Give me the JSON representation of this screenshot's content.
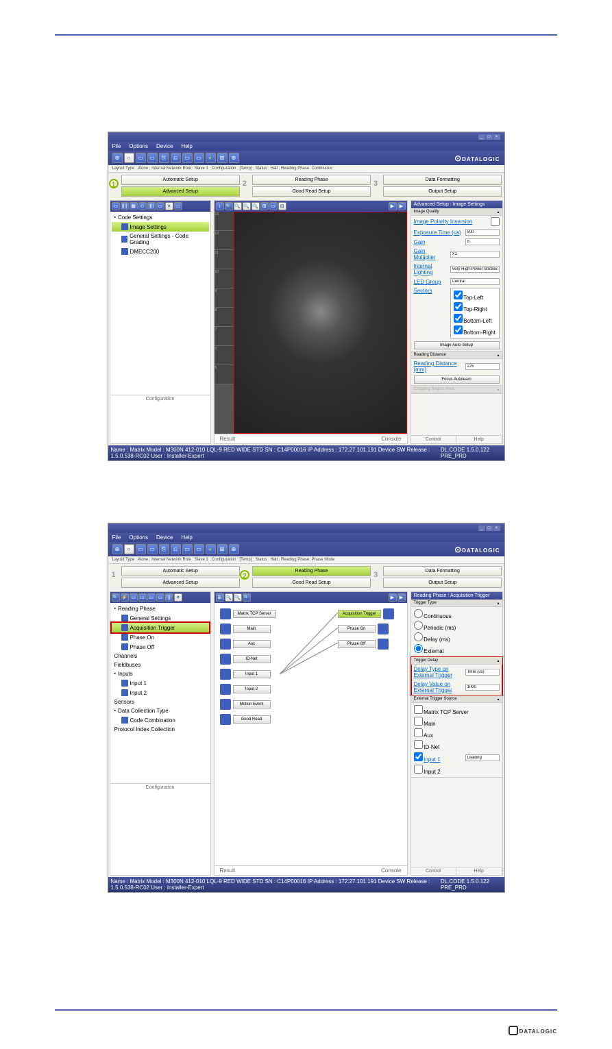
{
  "menubar": {
    "file": "File",
    "options": "Options",
    "device": "Device",
    "help": "Help"
  },
  "logo": "DATALOGIC",
  "screenshot1": {
    "breadcrumb": "Layout Type : Alone ; Internal Network Role : Slave 1 ; Configuration : [Temp] ; Status : Halt ; Reading Phase: Continuous",
    "workflow": {
      "automatic": "Automatic Setup",
      "advanced": "Advanced Setup",
      "reading": "Reading Phase",
      "goodread": "Good Read Setup",
      "dataformat": "Data Formatting",
      "output": "Output Setup"
    },
    "tree": {
      "header": "Code Settings",
      "items": [
        {
          "label": "Image Settings",
          "sel": true
        },
        {
          "label": "General Settings - Code Grading"
        },
        {
          "label": "DMECC200"
        }
      ]
    },
    "leftFooter": "Configuration",
    "centerFooter": {
      "left": "Result",
      "right": "Console"
    },
    "right": {
      "header": "Advanced Setup :  Image Settings",
      "imageQuality": "Image Quality",
      "polarityInv": "Image Polarity Inversion",
      "expTime": "Exposure Time (us)",
      "expVal": "500",
      "gain": "Gain",
      "gainVal": "8",
      "gainMult": "Gain Multiplier",
      "gainMultVal": "X1",
      "intLight": "Internal Lighting",
      "intLightVal": "Very High-Power Strobed",
      "ledGroup": "LED Group",
      "ledGroupVal": "Central",
      "sectors": "Sectors",
      "sectorList": [
        "Top-Left",
        "Top-Right",
        "Bottom-Left",
        "Bottom-Right"
      ],
      "autoSetup": "Image Auto-Setup",
      "readDist": "Reading Distance",
      "readDistMm": "Reading Distance (mm)",
      "readDistVal": "225",
      "focusAuto": "Focus Autolearn",
      "cropRegion": "Cropping Region Area"
    },
    "bottom": {
      "control": "Control",
      "help": "Help"
    },
    "statusbar": {
      "left": "Name : Matrix   Model : M300N 412-010 LQL-9 RED WIDE STD   SN : C14P00016   IP Address : 172.27.101.191   Device SW Release : 1.5.0.538-RC02   User : Installer-Expert",
      "right": "DL.CODE 1.5.0.122 PRE_PRD"
    }
  },
  "screenshot2": {
    "breadcrumb": "Layout Type : Alone ; Internal Network Role : Slave 1 ; Configuration : [Temp] ; Status : Halt ; Reading Phase: Phase Mode",
    "workflow": {
      "automatic": "Automatic Setup",
      "advanced": "Advanced Setup",
      "reading": "Reading Phase",
      "goodread": "Good Read Setup",
      "dataformat": "Data Formatting",
      "output": "Output Setup"
    },
    "tree": {
      "readingPhase": "Reading Phase",
      "items": [
        "General Settings",
        "Acquisition Trigger",
        "Phase On",
        "Phase Off"
      ],
      "channels": "Channels",
      "fieldbuses": "Fieldbuses",
      "inputs": "Inputs",
      "input1": "Input 1",
      "input2": "Input 2",
      "sensors": "Sensors",
      "dataCol": "Data Collection Type",
      "codeComb": "Code Combination",
      "protIndex": "Protocol Index Collection"
    },
    "nodes": {
      "matrixTcp": "Matrix TCP Server",
      "main": "Main",
      "aux": "Aux",
      "idnet": "ID-Net",
      "input1": "Input 1",
      "input2": "Input 2",
      "motion": "Motion Event",
      "goodRead": "Good Read",
      "acqTrig": "Acquisition Trigger",
      "phaseOn": "Phase On",
      "phaseOff": "Phase Off"
    },
    "right": {
      "header": "Reading Phase :  Acquisition Trigger",
      "trigType": "Trigger Type",
      "trigTypes": [
        "Continuous",
        "Periodic (ms)",
        "Delay (ms)",
        "External"
      ],
      "trigDelay": "Trigger Delay",
      "delayType": "Delay Type on External Trigger",
      "delayTypeVal": "Time (us)",
      "delayVal": "Delay Value on External Trigger",
      "delayValNum": "1000",
      "extSource": "External Trigger Source",
      "sources": [
        "Matrix TCP Server",
        "Main",
        "Aux",
        "ID-Net",
        "Input 1",
        "Input 2"
      ],
      "leading": "Leading"
    },
    "leftFooter": "Configuration",
    "centerFooter": {
      "left": "Result",
      "right": "Console"
    },
    "bottom": {
      "control": "Control",
      "help": "Help"
    },
    "statusbar": {
      "left": "Name : Matrix   Model : M300N 412-010 LQL-9 RED WIDE STD   SN : C14P00016   IP Address : 172.27.101.191   Device SW Release : 1.5.0.538-RC02   User : Installer-Expert",
      "right": "DL.CODE 1.5.0.122 PRE_PRD"
    }
  }
}
